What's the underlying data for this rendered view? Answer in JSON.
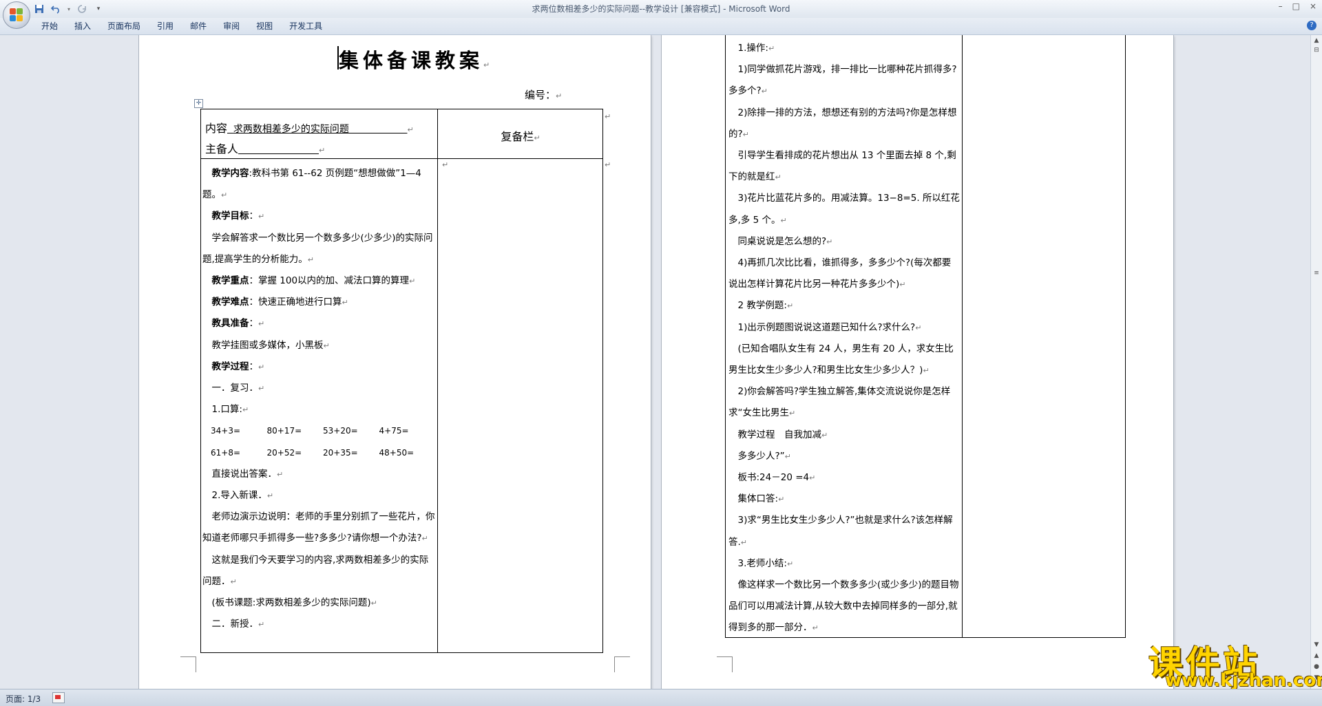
{
  "window": {
    "title": "求两位数相差多少的实际问题--教学设计 [兼容模式] - Microsoft Word",
    "controls": [
      "–",
      "□",
      "×"
    ]
  },
  "quick_access": {
    "save_icon": "save-icon",
    "undo_icon": "undo-icon",
    "redo_icon": "redo-icon",
    "customize": "▾"
  },
  "ribbon": {
    "tabs": [
      "开始",
      "插入",
      "页面布局",
      "引用",
      "邮件",
      "审阅",
      "视图",
      "开发工具"
    ],
    "help": "?"
  },
  "page1": {
    "title": "集体备课教案",
    "number_label": "编号：",
    "content_label": "内容",
    "content_value": "求两数相差多少的实际问题",
    "preparer_label": "主备人",
    "review_column": "复备栏",
    "lines": [
      {
        "bold": "教学内容",
        "text": ":教科书第 61--62 页例题“想想做做”1—4 题。"
      },
      {
        "bold": "教学目标",
        "text": "："
      },
      {
        "bold": "",
        "text": "学会解答求一个数比另一个数多多少(少多少)的实际问题,提高学生的分析能力。"
      },
      {
        "bold": "教学重点",
        "text": "：掌握 100以内的加、减法口算的算理"
      },
      {
        "bold": "教学难点",
        "text": "：快速正确地进行口算"
      },
      {
        "bold": "教具准备",
        "text": "："
      },
      {
        "bold": "",
        "text": "教学挂图或多媒体，小黑板"
      },
      {
        "bold": "教学过程",
        "text": "："
      },
      {
        "bold": "",
        "text": "一．复习．"
      },
      {
        "bold": "",
        "text": "1.口算:"
      }
    ],
    "calc_rows": [
      [
        "34+3=",
        "80+17=",
        "53+20=",
        "4+75="
      ],
      [
        "61+8=",
        "20+52=",
        "20+35=",
        "48+50="
      ]
    ],
    "lines_after": [
      "直接说出答案．",
      "2.导入新课．",
      "老师边演示边说明：老师的手里分别抓了一些花片，你知道老师哪只手抓得多一些?多多少?请你想一个办法?",
      "这就是我们今天要学习的内容,求两数相差多少的实际问题．",
      "(板书课题:求两数相差多少的实际问题)",
      "二．新授．"
    ]
  },
  "page2": {
    "lines": [
      "1.操作:",
      "1)同学做抓花片游戏，排一排比一比哪种花片抓得多?多多个?",
      "2)除排一排的方法，想想还有别的方法吗?你是怎样想的?",
      "引导学生看排成的花片想出从 13 个里面去掉 8 个,剩下的就是红",
      "3)花片比蓝花片多的。用减法算。13−8=5. 所以红花多,多 5 个。",
      "同桌说说是怎么想的?",
      "4)再抓几次比比看，谁抓得多，多多少个?(每次都要说出怎样计算花片比另一种花片多多少个)",
      "2 教学例题:",
      "1)出示例题图说说这道题已知什么?求什么?",
      "(已知合唱队女生有 24 人，男生有 20 人，求女生比男生比女生少多少人?和男生比女生少多少人？)",
      "2)你会解答吗?学生独立解答,集体交流说说你是怎样求“女生比男生",
      "教学过程　自我加减",
      "多多少人?”",
      "板书:24－20 =4",
      "集体口答:",
      "3)求“男生比女生少多少人?”也就是求什么?该怎样解答.",
      "3.老师小结:",
      "像这样求一个数比另一个数多多少(或少多少)的题目物品们可以用减法计算,从较大数中去掉同样多的一部分,就得到多的那一部分．"
    ]
  },
  "status": {
    "page": "页面: 1/3"
  },
  "watermark": {
    "brand": "课件站",
    "url": "www.kjzhan.com"
  },
  "colors": {
    "brand_yellow": "#ffd400",
    "title_blue": "#15315c"
  }
}
